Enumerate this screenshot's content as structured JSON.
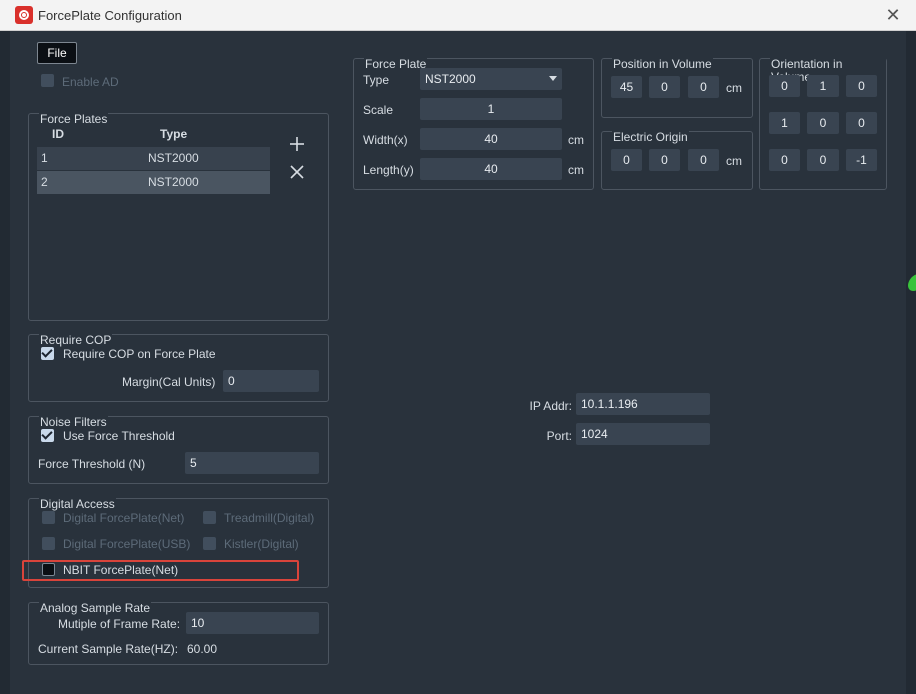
{
  "window": {
    "title": "ForcePlate Configuration",
    "app_icon": "forceplate-logo-icon",
    "close_icon": "close-x-icon"
  },
  "menu": {
    "file_label": "File"
  },
  "enable_ad": {
    "label": "Enable AD"
  },
  "force_plates": {
    "title": "Force Plates",
    "headers": {
      "id": "ID",
      "type": "Type"
    },
    "rows": [
      {
        "id": "1",
        "type": "NST2000"
      },
      {
        "id": "2",
        "type": "NST2000"
      }
    ],
    "add_icon": "plus-icon",
    "remove_icon": "x-icon"
  },
  "require_cop": {
    "title": "Require COP",
    "checkbox_label": "Require COP on Force Plate",
    "margin_label": "Margin(Cal Units)",
    "margin_value": "0"
  },
  "noise_filters": {
    "title": "Noise Filters",
    "checkbox_label": "Use Force Threshold",
    "threshold_label": "Force Threshold (N)",
    "threshold_value": "5"
  },
  "digital_access": {
    "title": "Digital Access",
    "digital_net": "Digital ForcePlate(Net)",
    "treadmill": "Treadmill(Digital)",
    "digital_usb": "Digital ForcePlate(USB)",
    "kistler": "Kistler(Digital)",
    "nbit": "NBIT ForcePlate(Net)"
  },
  "analog_sample_rate": {
    "title": "Analog Sample Rate",
    "multiple_label": "Mutiple of Frame Rate:",
    "multiple_value": "10",
    "current_label": "Current Sample Rate(HZ):",
    "current_value": "60.00"
  },
  "force_plate": {
    "title": "Force Plate",
    "type_label": "Type",
    "type_value": "NST2000",
    "scale_label": "Scale",
    "scale_value": "1",
    "width_label": "Width(x)",
    "width_value": "40",
    "width_unit": "cm",
    "length_label": "Length(y)",
    "length_value": "40",
    "length_unit": "cm"
  },
  "position_in_volume": {
    "title": "Position in Volume",
    "values": [
      "45",
      "0",
      "0"
    ],
    "unit": "cm"
  },
  "electric_origin": {
    "title": "Electric Origin",
    "values": [
      "0",
      "0",
      "0"
    ],
    "unit": "cm"
  },
  "orientation_in_volume": {
    "title": "Orientation in Volume",
    "values": [
      "0",
      "1",
      "0",
      "1",
      "0",
      "0",
      "0",
      "0",
      "-1"
    ]
  },
  "network": {
    "ip_label": "IP Addr:",
    "ip_value": "10.1.1.196",
    "port_label": "Port:",
    "port_value": "1024"
  },
  "colors": {
    "background": "#29323c",
    "field": "#394451",
    "highlight": "#d9443b"
  }
}
